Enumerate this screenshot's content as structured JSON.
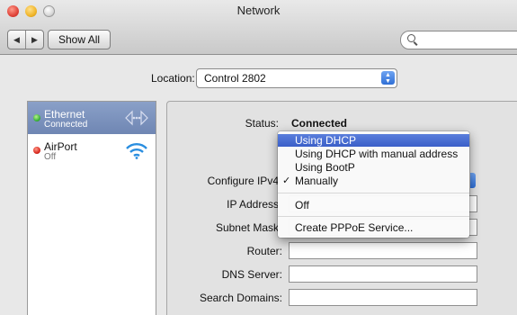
{
  "window": {
    "title": "Network"
  },
  "toolbar": {
    "back_glyph": "◀",
    "forward_glyph": "▶",
    "show_all_label": "Show All",
    "search_placeholder": ""
  },
  "location": {
    "label": "Location:",
    "value": "Control 2802"
  },
  "services": [
    {
      "name": "Ethernet",
      "status": "Connected",
      "indicator": "green",
      "icon": "ethernet-icon",
      "selected": true
    },
    {
      "name": "AirPort",
      "status": "Off",
      "indicator": "red",
      "icon": "wifi-icon",
      "selected": false
    }
  ],
  "panel": {
    "status_label": "Status:",
    "status_value": "Connected",
    "configure_label": "Configure IPv4",
    "ip_label": "IP Address",
    "subnet_label": "Subnet Mask",
    "router_label": "Router:",
    "dns_label": "DNS Server:",
    "search_domains_label": "Search Domains:"
  },
  "menu": {
    "items": [
      {
        "label": "Using DHCP",
        "highlighted": true,
        "checked": false
      },
      {
        "label": "Using DHCP with manual address",
        "highlighted": false,
        "checked": false
      },
      {
        "label": "Using BootP",
        "highlighted": false,
        "checked": false
      },
      {
        "label": "Manually",
        "highlighted": false,
        "checked": true
      },
      {
        "label": "Off",
        "highlighted": false,
        "checked": false
      },
      {
        "label": "Create PPPoE Service...",
        "highlighted": false,
        "checked": false
      }
    ],
    "check_glyph": "✓"
  },
  "colors": {
    "selection_blue": "#3a5fc8",
    "list_selected": "#7a90bd",
    "wifi_blue": "#2a8ee0"
  }
}
